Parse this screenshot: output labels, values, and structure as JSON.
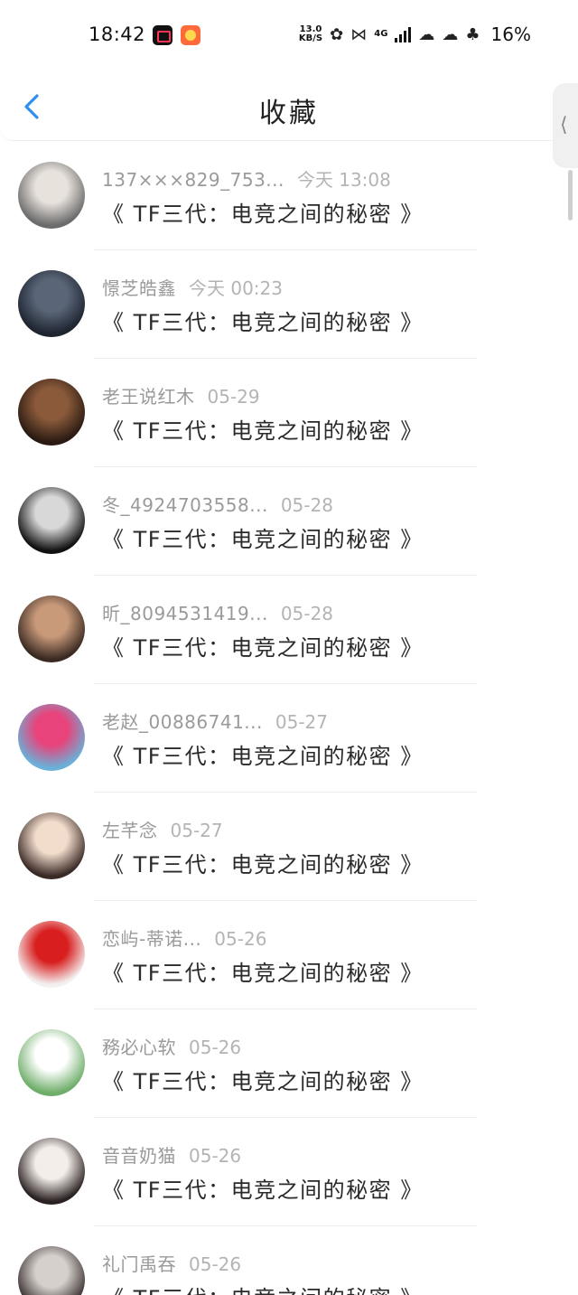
{
  "status_bar": {
    "time": "18:42",
    "net_speed_value": "13.0",
    "net_speed_unit": "KB/S",
    "network_type": "4G",
    "battery": "16%"
  },
  "header": {
    "title": "收藏",
    "back_icon": "chevron-left-icon",
    "side_handle_glyph": "⟨"
  },
  "colors": {
    "accent": "#2e8ff0",
    "meta_text": "#9a9a9a",
    "time_text": "#b4b4b4",
    "title_text": "#2a2a2a"
  },
  "favorites": [
    {
      "user": "137×××829_753...",
      "time": "今天 13:08",
      "title": "《 TF三代：电竞之间的秘密 》",
      "avatar_colors": [
        "#e8e2dc",
        "#6b6b6b"
      ]
    },
    {
      "user": "憬芝皓鑫",
      "time": "今天 00:23",
      "title": "《 TF三代：电竞之间的秘密 》",
      "avatar_colors": [
        "#5a6678",
        "#1e2430"
      ]
    },
    {
      "user": "老王说红木",
      "time": "05-29",
      "title": "《 TF三代：电竞之间的秘密 》",
      "avatar_colors": [
        "#8a5a3a",
        "#2a1a12"
      ]
    },
    {
      "user": "冬_4924703558...",
      "time": "05-28",
      "title": "《 TF三代：电竞之间的秘密 》",
      "avatar_colors": [
        "#d8d8d8",
        "#111111"
      ]
    },
    {
      "user": "昕_8094531419...",
      "time": "05-28",
      "title": "《 TF三代：电竞之间的秘密 》",
      "avatar_colors": [
        "#c99a7a",
        "#3a2a22"
      ]
    },
    {
      "user": "老赵_00886741...",
      "time": "05-27",
      "title": "《 TF三代：电竞之间的秘密 》",
      "avatar_colors": [
        "#e8437a",
        "#6ab0d8"
      ]
    },
    {
      "user": "左芊念",
      "time": "05-27",
      "title": "《 TF三代：电竞之间的秘密 》",
      "avatar_colors": [
        "#f2dccc",
        "#3a2a26"
      ]
    },
    {
      "user": "恋屿-蒂诺...",
      "time": "05-26",
      "title": "《 TF三代：电竞之间的秘密 》",
      "avatar_colors": [
        "#d81e1e",
        "#f4f0f0"
      ]
    },
    {
      "user": "務必心软",
      "time": "05-26",
      "title": "《 TF三代：电竞之间的秘密 》",
      "avatar_colors": [
        "#ffffff",
        "#6fae6a"
      ]
    },
    {
      "user": "音音奶猫",
      "time": "05-26",
      "title": "《 TF三代：电竞之间的秘密 》",
      "avatar_colors": [
        "#f4eeea",
        "#2a2222"
      ]
    },
    {
      "user": "礼门禹吞",
      "time": "05-26",
      "title": "《 TF三代：电竞之间的秘密 》",
      "avatar_colors": [
        "#d6d0cc",
        "#3a3232"
      ]
    }
  ]
}
